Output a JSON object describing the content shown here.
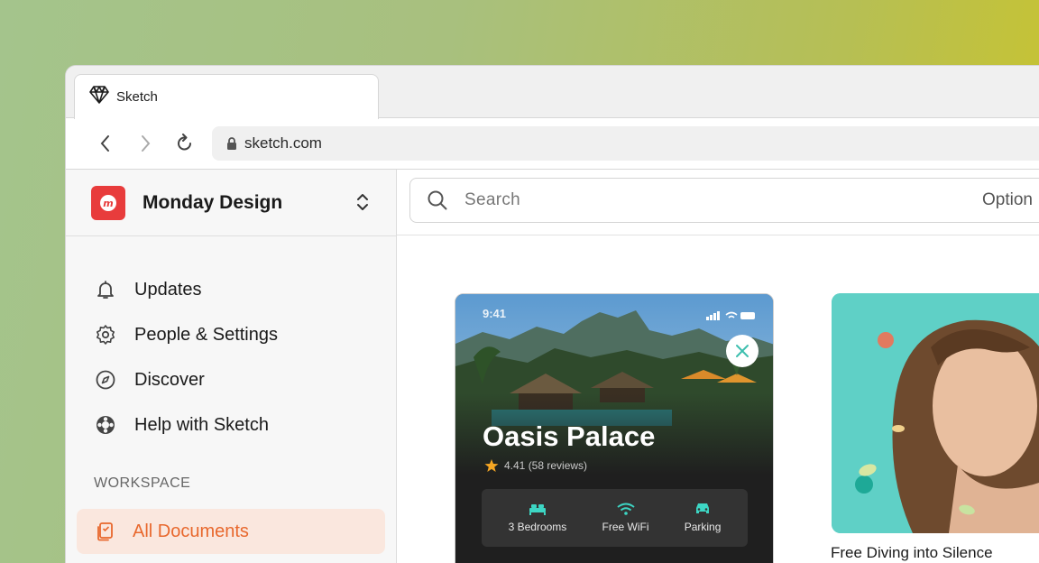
{
  "browser": {
    "tab_title": "Sketch",
    "url": "sketch.com"
  },
  "workspace": {
    "name": "Monday Design"
  },
  "sidebar": {
    "items": [
      {
        "label": "Updates",
        "icon": "bell-icon"
      },
      {
        "label": "People & Settings",
        "icon": "gear-icon"
      },
      {
        "label": "Discover",
        "icon": "compass-icon"
      },
      {
        "label": "Help with Sketch",
        "icon": "lifebuoy-icon"
      }
    ],
    "section_label": "WORKSPACE",
    "active_item": {
      "label": "All Documents",
      "icon": "documents-icon"
    }
  },
  "search": {
    "placeholder": "Search",
    "option_label": "Option"
  },
  "documents": [
    {
      "status_time": "9:41",
      "title": "Oasis Palace",
      "rating": "4.41 (58 reviews)",
      "amenities": [
        {
          "label": "3 Bedrooms",
          "icon": "bed-icon"
        },
        {
          "label": "Free WiFi",
          "icon": "wifi-icon"
        },
        {
          "label": "Parking",
          "icon": "car-icon"
        }
      ]
    },
    {
      "caption": "Free Diving into Silence"
    }
  ],
  "colors": {
    "accent": "#e8682d",
    "active_bg": "#fae7de",
    "brand_logo": "#e83c3c",
    "amenity_icon": "#3dd6c4"
  }
}
